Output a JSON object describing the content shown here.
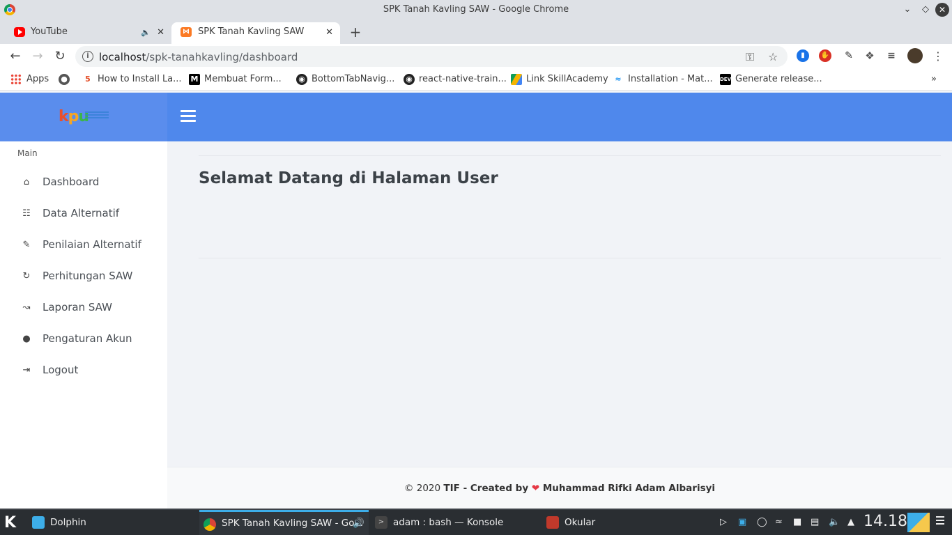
{
  "window": {
    "title": "SPK Tanah Kavling SAW - Google Chrome"
  },
  "tabs": [
    {
      "label": "YouTube",
      "icon": "youtube-icon"
    },
    {
      "label": "SPK Tanah Kavling SAW",
      "icon": "xampp-icon"
    }
  ],
  "toolbar": {
    "url_host": "localhost",
    "url_path": "/spk-tanahkavling/dashboard"
  },
  "bookmarks": [
    {
      "label": "Apps",
      "icon": "apps-grid-icon"
    },
    {
      "label": "",
      "icon": "globe-icon"
    },
    {
      "label": "How to Install La...",
      "icon": "html5-icon"
    },
    {
      "label": "Membuat Form...",
      "icon": "medium-icon"
    },
    {
      "label": "BottomTabNavig...",
      "icon": "github-icon"
    },
    {
      "label": "react-native-train...",
      "icon": "github-icon"
    },
    {
      "label": "Link SkillAcademy",
      "icon": "google-drive-icon"
    },
    {
      "label": "Installation - Mat...",
      "icon": "material-icon"
    },
    {
      "label": "Generate release...",
      "icon": "dev-icon"
    }
  ],
  "sidebar": {
    "heading": "Main",
    "items": [
      {
        "label": "Dashboard",
        "icon": "home-icon"
      },
      {
        "label": "Data Alternatif",
        "icon": "database-icon"
      },
      {
        "label": "Penilaian Alternatif",
        "icon": "pencil-icon"
      },
      {
        "label": "Perhitungan SAW",
        "icon": "refresh-icon"
      },
      {
        "label": "Laporan SAW",
        "icon": "chart-line-icon"
      },
      {
        "label": "Pengaturan Akun",
        "icon": "user-icon"
      },
      {
        "label": "Logout",
        "icon": "logout-icon"
      }
    ]
  },
  "main": {
    "title": "Selamat Datang di Halaman User"
  },
  "footer": {
    "prefix": "© 2020 ",
    "org": "TIF",
    "created": " - Created by ",
    "author": " Muhammad Rifki Adam Albarisyi"
  },
  "taskbar": {
    "tasks": [
      {
        "label": "Dolphin"
      },
      {
        "label": "SPK Tanah Kavling SAW - Go..."
      },
      {
        "label": "adam : bash — Konsole"
      },
      {
        "label": "Okular"
      }
    ],
    "clock": "14.18"
  },
  "colors": {
    "brand_blue": "#5a8ded",
    "topbar_blue": "#4f88ec",
    "page_bg": "#f1f3f7",
    "heart": "#e53945"
  }
}
